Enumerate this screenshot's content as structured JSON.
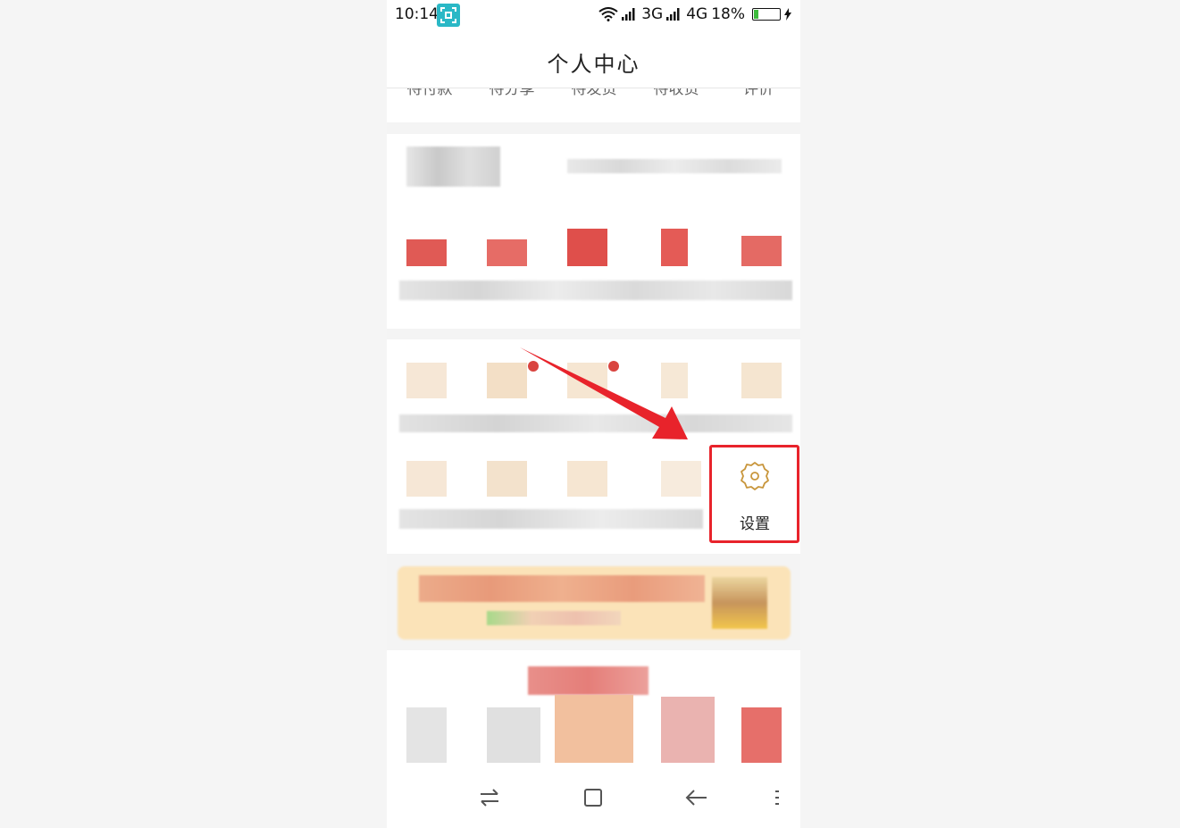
{
  "status_bar": {
    "time": "10:14",
    "network_3g": "3G",
    "network_4g": "4G",
    "battery_percent": "18%",
    "battery_level": 0.18
  },
  "header": {
    "title": "个人中心"
  },
  "order_tabs": [
    "待付款",
    "待分享",
    "待发货",
    "待收货",
    "评价"
  ],
  "settings": {
    "label": "设置",
    "icon": "gear-icon"
  },
  "annotation": {
    "highlight_color": "#e8232b",
    "arrow_color": "#e8232b"
  },
  "colors": {
    "accent_gold": "#c8963c",
    "teal": "#2ab8c6"
  }
}
